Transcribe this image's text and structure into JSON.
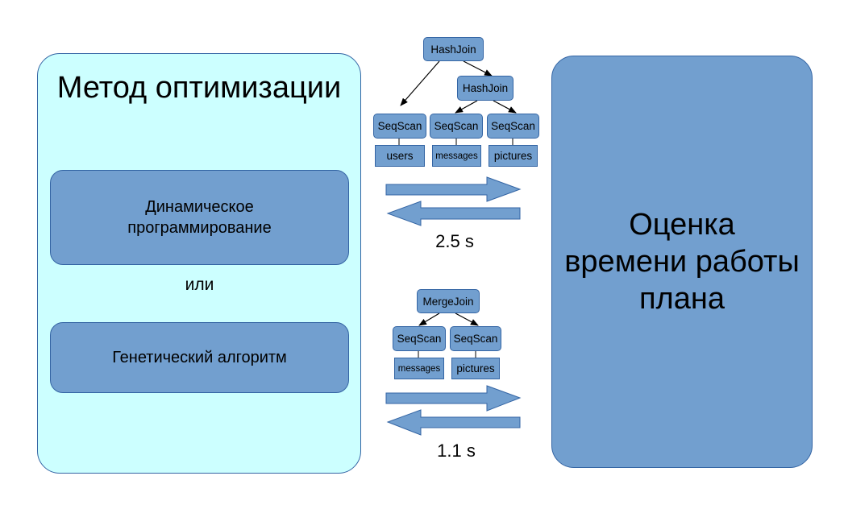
{
  "left_panel": {
    "title": "Метод оптимизации",
    "methods": [
      {
        "label_line1": "Динамическое",
        "label_line2": "программирование"
      },
      {
        "label_line1": "Генетический алгоритм",
        "label_line2": ""
      }
    ],
    "separator": "или"
  },
  "right_panel": {
    "line1": "Оценка",
    "line2": "времени работы",
    "line3": "плана"
  },
  "plans": [
    {
      "root": "HashJoin",
      "inner_join": "HashJoin",
      "scans": [
        "SeqScan",
        "SeqScan",
        "SeqScan"
      ],
      "tables": [
        "users",
        "messages",
        "pictures"
      ],
      "time": "2.5 s"
    },
    {
      "root": "MergeJoin",
      "scans": [
        "SeqScan",
        "SeqScan"
      ],
      "tables": [
        "messages",
        "pictures"
      ],
      "time": "1.1 s"
    }
  ],
  "colors": {
    "left_panel_fill": "#ccffff",
    "box_fill": "#729fcf",
    "border": "#3465a4"
  }
}
